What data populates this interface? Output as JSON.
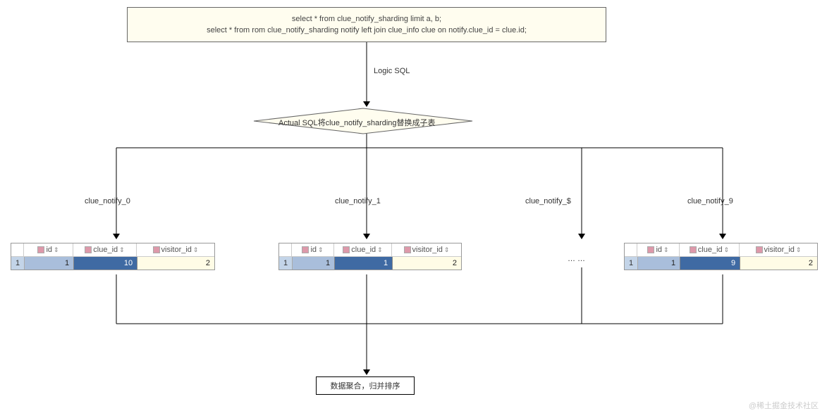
{
  "sql_box": {
    "line1": "select * from  clue_notify_sharding limit a, b;",
    "line2": "select * from rom  clue_notify_sharding notify left join clue_info clue on notify.clue_id = clue.id;"
  },
  "labels": {
    "logic_sql": "Logic SQL",
    "diamond": "Actual SQL将clue_notify_sharding替换成子表"
  },
  "branches": {
    "b0": "clue_notify_0",
    "b1": "clue_notify_1",
    "b2": "clue_notify_$",
    "b3": "clue_notify_9"
  },
  "tables": {
    "headers": {
      "id": "id",
      "clue_id": "clue_id",
      "visitor_id": "visitor_id"
    },
    "t0": {
      "rownum": "1",
      "id": "1",
      "clue_id": "10",
      "visitor_id": "2"
    },
    "t1": {
      "rownum": "1",
      "id": "1",
      "clue_id": "1",
      "visitor_id": "2"
    },
    "t3": {
      "rownum": "1",
      "id": "1",
      "clue_id": "9",
      "visitor_id": "2"
    }
  },
  "ellipsis": "… …",
  "final_box": "数据聚合，归并排序",
  "watermark": "@稀土掘金技术社区",
  "colors": {
    "box_bg": "#fffdef",
    "header_sel": "#3f6aa3"
  }
}
